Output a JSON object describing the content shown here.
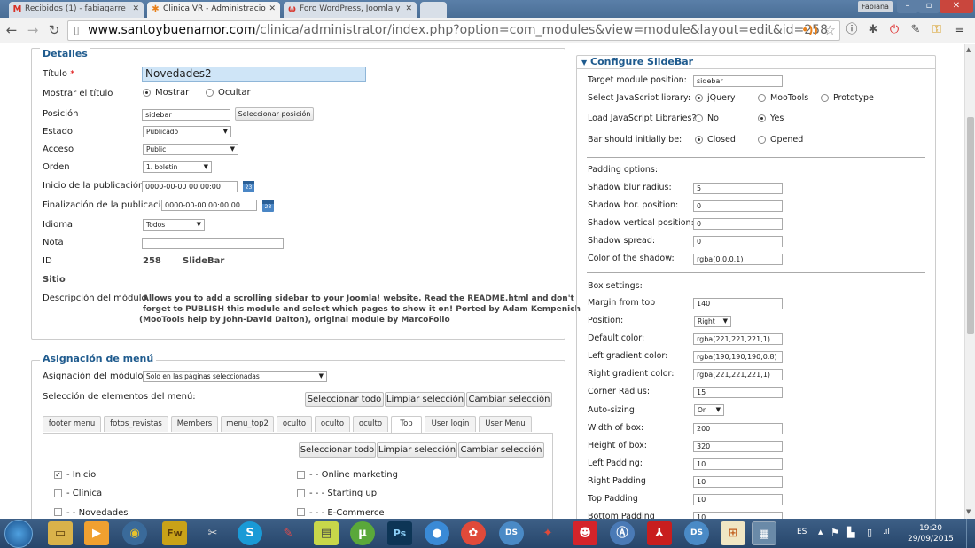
{
  "browser": {
    "tabs": [
      {
        "label": "Recibidos (1) - fabiagarre",
        "icon": "gmail-icon"
      },
      {
        "label": "Clinica VR - Administracio",
        "icon": "joomla-icon"
      },
      {
        "label": "Foro WordPress, Joomla y",
        "icon": "forum-icon"
      }
    ],
    "user_label": "Fabiana",
    "url_host": "www.santoybuenamor.com",
    "url_path": "/clinica/administrator/index.php?option=com_modules&view=module&layout=edit&id=258"
  },
  "details": {
    "legend": "Detalles",
    "title_label": "Título",
    "title_value": "Novedades2",
    "show_title_label": "Mostrar el título",
    "show_option": "Mostrar",
    "hide_option": "Ocultar",
    "position_label": "Posición",
    "position_value": "sidebar",
    "select_position_btn": "Seleccionar posición",
    "state_label": "Estado",
    "state_value": "Publicado",
    "access_label": "Acceso",
    "access_value": "Public",
    "order_label": "Orden",
    "order_value": "1. boletin",
    "publish_start_label": "Inicio de la publicación",
    "publish_start_value": "0000-00-00 00:00:00",
    "publish_end_label": "Finalización de la publicación",
    "publish_end_value": "0000-00-00 00:00:00",
    "calendar_day": "23",
    "language_label": "Idioma",
    "language_value": "Todos",
    "note_label": "Nota",
    "id_label": "ID",
    "id_value": "258",
    "module_type": "SlideBar",
    "site_label": "Sitio",
    "description_label": "Descripción del módulo",
    "description_lines": [
      "Allows you to add a scrolling sidebar to your Joomla! website. Read the README.html and don't",
      "forget to PUBLISH this module and select which pages to show it on! Ported by Adam Kempenich",
      "(MooTools help by John-David Dalton), original module by MarcoFolio"
    ]
  },
  "menu_assignment": {
    "legend": "Asignación de menú",
    "assignment_label": "Asignación del módulo",
    "assignment_value": "Solo en las páginas seleccionadas",
    "selection_label": "Selección de elementos del menú:",
    "select_all": "Seleccionar todo",
    "clear_selection": "Limpiar selección",
    "toggle_selection": "Cambiar selección",
    "tabs": [
      "footer menu",
      "fotos_revistas",
      "Members",
      "menu_top2",
      "oculto",
      "oculto",
      "oculto",
      "Top",
      "User login",
      "User Menu"
    ],
    "active_tab": "Top",
    "left_items": [
      {
        "label": "- Inicio",
        "checked": true
      },
      {
        "label": "- Clínica",
        "checked": false
      },
      {
        "label": "- - Novedades",
        "checked": false
      }
    ],
    "right_items": [
      {
        "label": "- - Online marketing",
        "checked": false
      },
      {
        "label": "- - - Starting up",
        "checked": false
      },
      {
        "label": "- - - E-Commerce",
        "checked": false
      }
    ]
  },
  "slidebar": {
    "legend": "Configure SlideBar",
    "target_label": "Target module position:",
    "target_value": "sidebar",
    "js_lib_label": "Select JavaScript library:",
    "js_options": [
      "jQuery",
      "MooTools",
      "Prototype"
    ],
    "js_selected": "jQuery",
    "load_js_label": "Load JavaScript Libraries?",
    "load_no": "No",
    "load_yes": "Yes",
    "initial_label": "Bar should initially be:",
    "closed": "Closed",
    "opened": "Opened",
    "padding_header": "Padding options:",
    "shadow_blur_label": "Shadow blur radius:",
    "shadow_blur_value": "5",
    "shadow_hor_label": "Shadow hor. position:",
    "shadow_hor_value": "0",
    "shadow_vert_label": "Shadow vertical position:",
    "shadow_vert_value": "0",
    "shadow_spread_label": "Shadow spread:",
    "shadow_spread_value": "0",
    "shadow_color_label": "Color of the shadow:",
    "shadow_color_value": "rgba(0,0,0,1)",
    "box_header": "Box settings:",
    "margin_top_label": "Margin from top",
    "margin_top_value": "140",
    "position_label": "Position:",
    "position_value": "Right",
    "default_color_label": "Default color:",
    "default_color_value": "rgba(221,221,221,1)",
    "left_gradient_label": "Left gradient color:",
    "left_gradient_value": "rgba(190,190,190,0.8)",
    "right_gradient_label": "Right gradient color:",
    "right_gradient_value": "rgba(221,221,221,1)",
    "corner_label": "Corner Radius:",
    "corner_value": "15",
    "autosize_label": "Auto-sizing:",
    "autosize_value": "On",
    "width_label": "Width of box:",
    "width_value": "200",
    "height_label": "Height of box:",
    "height_value": "320",
    "left_pad_label": "Left Padding:",
    "left_pad_value": "10",
    "right_pad_label": "Right Padding",
    "right_pad_value": "10",
    "top_pad_label": "Top Padding",
    "top_pad_value": "10",
    "bottom_pad_label": "Bottom Padding",
    "bottom_pad_value": "10"
  },
  "taskbar": {
    "language": "ES",
    "time": "19:20",
    "date": "29/09/2015"
  },
  "colors": {
    "legend_blue": "#1f5b8e",
    "title_input_bg": "#cfe5f7",
    "taskbar": "#2d4f78"
  }
}
